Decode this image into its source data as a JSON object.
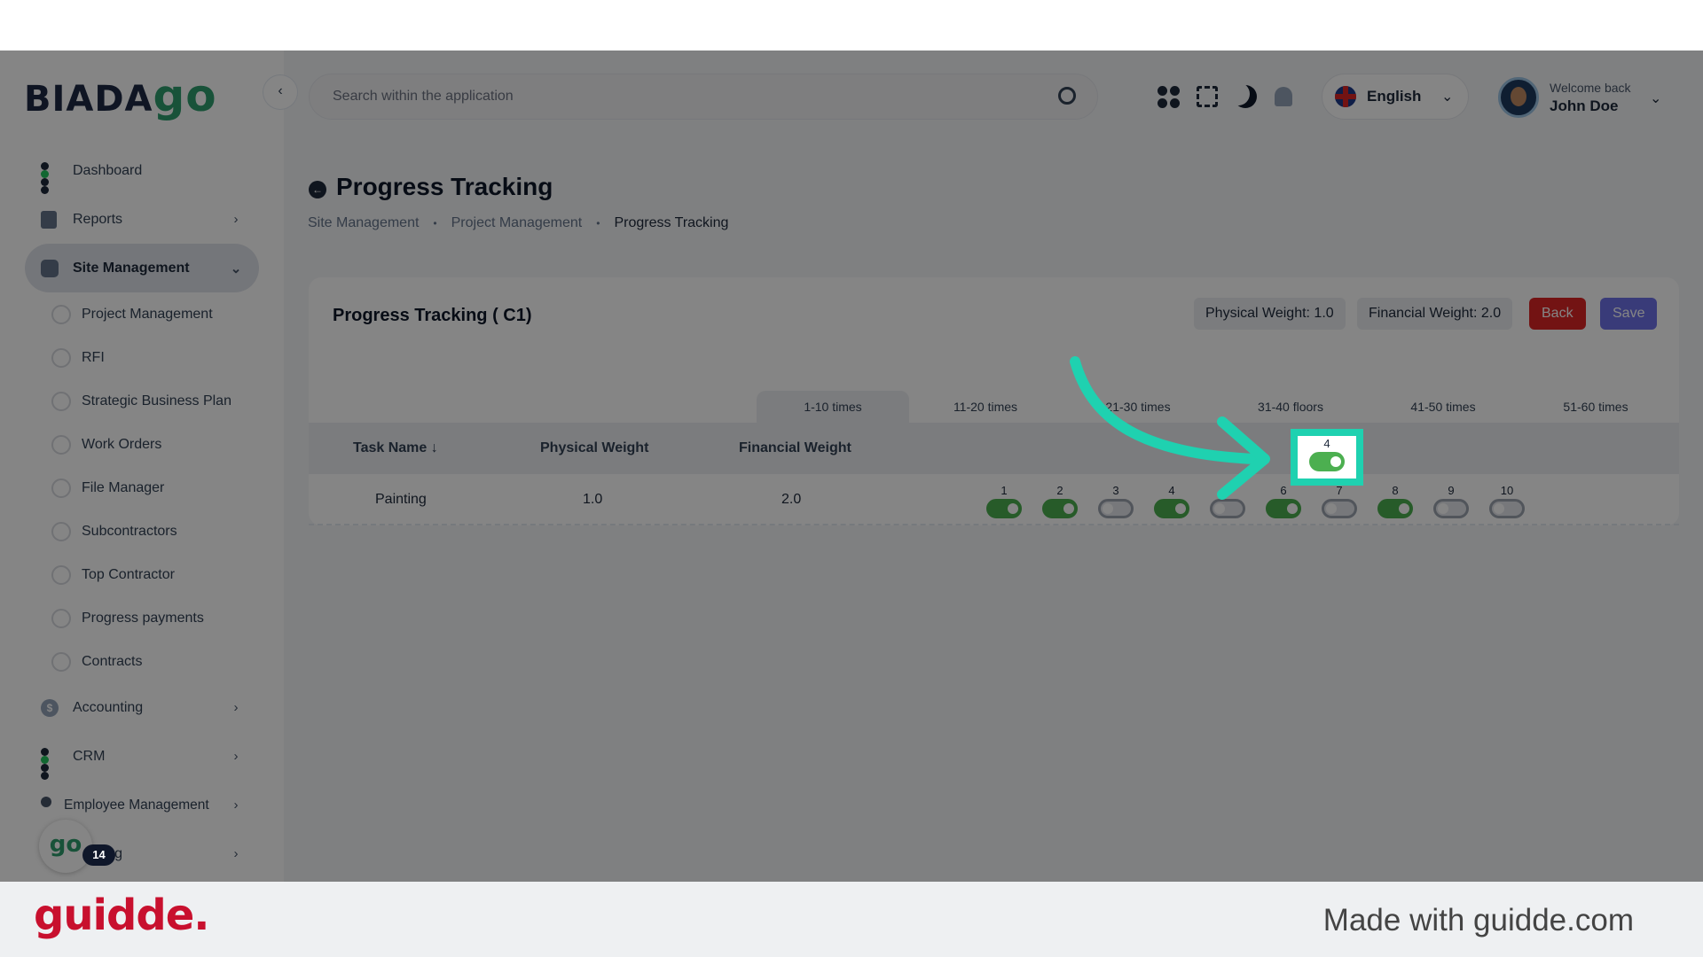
{
  "sidebar": {
    "logo": {
      "main": "BIADA",
      "accent": "go"
    },
    "items": [
      {
        "label": "Dashboard",
        "icon": "dashboard-icon"
      },
      {
        "label": "Reports",
        "icon": "reports-icon"
      },
      {
        "label": "Site Management",
        "icon": "site-management-icon"
      }
    ],
    "sub_items": [
      "Project Management",
      "RFI",
      "Strategic Business Plan",
      "Work Orders",
      "File Manager",
      "Subcontractors",
      "Top Contractor",
      "Progress payments",
      "Contracts"
    ],
    "lower_items": [
      {
        "label": "Accounting",
        "icon": "accounting-icon"
      },
      {
        "label": "CRM",
        "icon": "crm-icon"
      },
      {
        "label": "Employee Management",
        "icon": "employee-icon"
      },
      {
        "label": "Leasing",
        "icon": "leasing-icon"
      }
    ],
    "go_badge": "go",
    "notification_count": "14"
  },
  "header": {
    "search_placeholder": "Search within the application",
    "language": "English",
    "welcome": "Welcome back",
    "user_name": "John Doe"
  },
  "page": {
    "title": "Progress Tracking",
    "breadcrumb": [
      "Site Management",
      "Project Management",
      "Progress Tracking"
    ]
  },
  "card": {
    "title": "Progress Tracking ( C1)",
    "physical_weight_chip": "Physical Weight: 1.0",
    "financial_weight_chip": "Financial Weight: 2.0",
    "back_label": "Back",
    "save_label": "Save",
    "tabs": [
      "1-10 times",
      "11-20 times",
      "21-30 times",
      "31-40 floors",
      "41-50 times",
      "51-60 times"
    ],
    "columns": [
      "Task Name",
      "Physical Weight",
      "Financial Weight"
    ],
    "row": {
      "task_name": "Painting",
      "physical_weight": "1.0",
      "financial_weight": "2.0",
      "toggles": [
        {
          "num": "1",
          "on": true
        },
        {
          "num": "2",
          "on": true
        },
        {
          "num": "3",
          "on": false
        },
        {
          "num": "4",
          "on": true
        },
        {
          "num": "5",
          "on": false
        },
        {
          "num": "6",
          "on": true
        },
        {
          "num": "7",
          "on": false
        },
        {
          "num": "8",
          "on": true
        },
        {
          "num": "9",
          "on": false
        },
        {
          "num": "10",
          "on": false
        }
      ]
    }
  },
  "footer": {
    "brand": "guidde.",
    "made_with": "Made with guidde.com"
  },
  "colors": {
    "accent_highlight": "#1fd1b0",
    "toggle_on": "#4caf50",
    "back_button": "#dc2626",
    "save_button": "#6d71e8",
    "brand_red": "#c8102e"
  }
}
